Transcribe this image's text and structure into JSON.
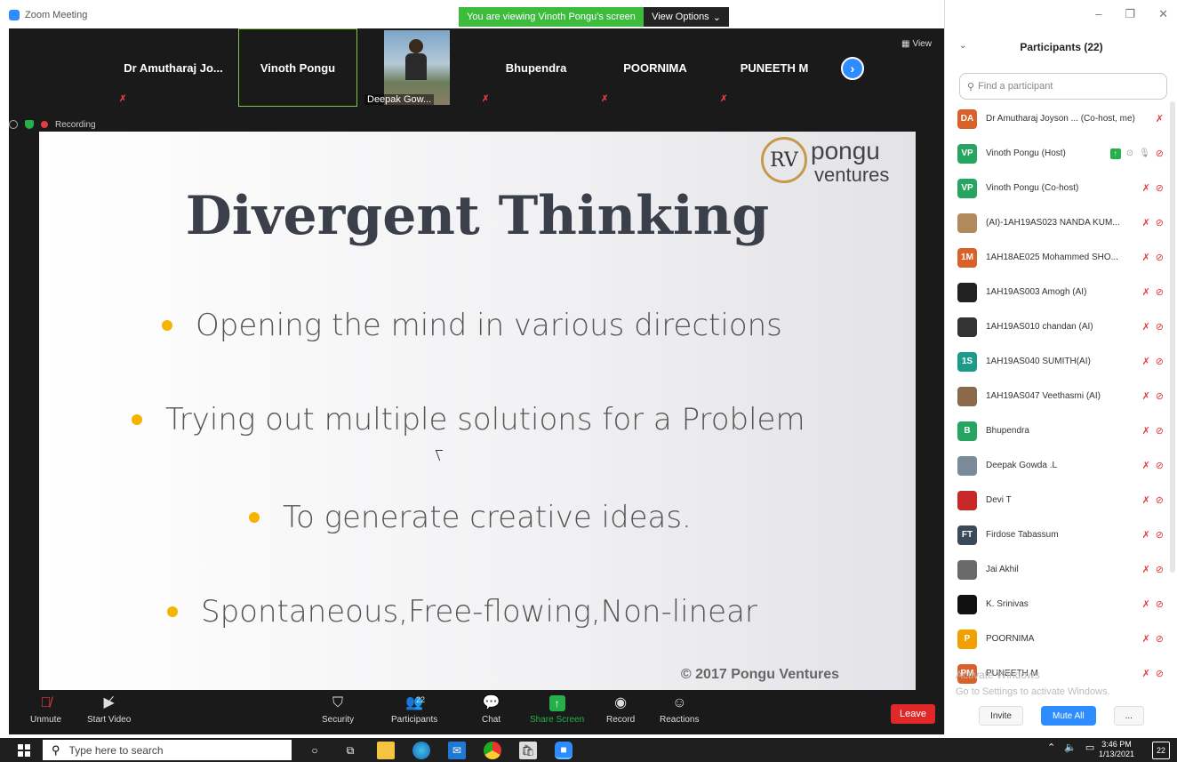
{
  "window": {
    "title": "Zoom Meeting",
    "viewing_banner": "You are viewing Vinoth Pongu's screen",
    "view_options": "View Options",
    "controls": {
      "minimize": "–",
      "restore": "❐",
      "close": "✕"
    }
  },
  "video_strip": {
    "tiles": [
      {
        "name": "Dr Amutharaj Jo..."
      },
      {
        "name": "Vinoth Pongu"
      },
      {
        "name": "Deepak Gow..."
      },
      {
        "name": "Bhupendra"
      },
      {
        "name": "POORNIMA"
      },
      {
        "name": "PUNEETH M"
      }
    ],
    "view_label": "View",
    "recording_label": "Recording"
  },
  "slide": {
    "title": "Divergent Thinking",
    "bullets": [
      "Opening the mind in various directions",
      "Trying out multiple solutions for a Problem",
      "To generate creative ideas.",
      "Spontaneous,Free-flowing,Non-linear"
    ],
    "copyright": "© 2017 Pongu Ventures",
    "logo_line1": "pongu",
    "logo_line2": "ventures",
    "logo_mark": "RV"
  },
  "toolbar": {
    "unmute": "Unmute",
    "start_video": "Start Video",
    "security": "Security",
    "participants": "Participants",
    "participants_count": "22",
    "chat": "Chat",
    "share_screen": "Share Screen",
    "record": "Record",
    "reactions": "Reactions",
    "leave": "Leave"
  },
  "panel": {
    "title": "Participants (22)",
    "search_placeholder": "Find a participant",
    "participants": [
      {
        "initials": "DA",
        "name": "Dr Amutharaj Joyson ... (Co-host, me)",
        "color": "#d9622b"
      },
      {
        "initials": "VP",
        "name": "Vinoth Pongu (Host)",
        "color": "#25a55f"
      },
      {
        "initials": "VP",
        "name": "Vinoth Pongu (Co-host)",
        "color": "#25a55f"
      },
      {
        "initials": "",
        "name": "(AI)-1AH19AS023 NANDA KUM...",
        "color": "#b08a5a"
      },
      {
        "initials": "1M",
        "name": "1AH18AE025 Mohammed SHO...",
        "color": "#d9622b"
      },
      {
        "initials": "",
        "name": "1AH19AS003 Amogh (AI)",
        "color": "#222222"
      },
      {
        "initials": "",
        "name": "1AH19AS010 chandan (AI)",
        "color": "#333333"
      },
      {
        "initials": "1S",
        "name": "1AH19AS040 SUMITH(AI)",
        "color": "#1d9a8a"
      },
      {
        "initials": "",
        "name": "1AH19AS047 Veethasmi (AI)",
        "color": "#8a6a4a"
      },
      {
        "initials": "B",
        "name": "Bhupendra",
        "color": "#25a55f"
      },
      {
        "initials": "",
        "name": "Deepak Gowda .L",
        "color": "#7a8a9a"
      },
      {
        "initials": "",
        "name": "Devi T",
        "color": "#c62828"
      },
      {
        "initials": "FT",
        "name": "Firdose Tabassum",
        "color": "#3a4a5a"
      },
      {
        "initials": "",
        "name": "Jai Akhil",
        "color": "#6a6a6a"
      },
      {
        "initials": "",
        "name": "K. Srinivas",
        "color": "#111111"
      },
      {
        "initials": "P",
        "name": "POORNIMA",
        "color": "#f0a000"
      },
      {
        "initials": "PM",
        "name": "PUNEETH M",
        "color": "#d9622b"
      }
    ],
    "activate_line1": "Activate Windows",
    "activate_line2": "Go to Settings to activate Windows.",
    "invite": "Invite",
    "mute_all": "Mute All",
    "more": "..."
  },
  "taskbar": {
    "search_placeholder": "Type here to search",
    "time": "3:46 PM",
    "date": "1/13/2021",
    "notifications": "22"
  }
}
